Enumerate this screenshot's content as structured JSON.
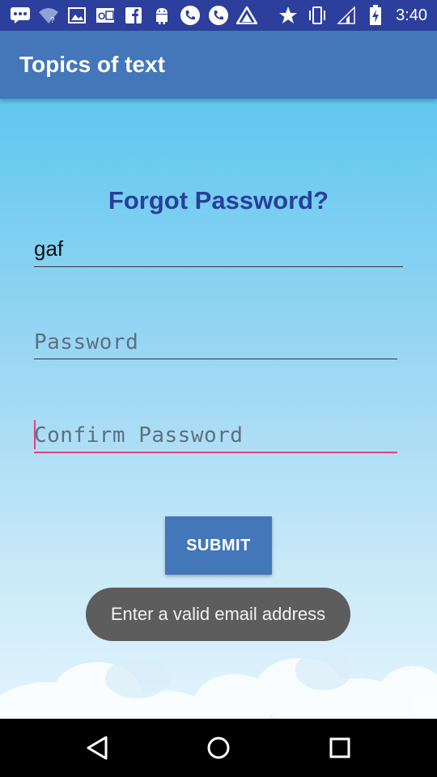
{
  "status_bar": {
    "time": "3:40",
    "icons_left": [
      "chat-icon",
      "wifi-question-icon",
      "image-icon",
      "outlook-icon",
      "facebook-icon",
      "android-icon",
      "phone-icon",
      "phone-icon",
      "app-icon"
    ],
    "icons_right": [
      "star-icon",
      "vibrate-icon",
      "signal-icon",
      "battery-charging-icon"
    ]
  },
  "app_bar": {
    "title": "Topics of text"
  },
  "form": {
    "heading": "Forgot Password?",
    "email_value": "gaf",
    "password_placeholder": "Password",
    "confirm_placeholder": "Confirm Password",
    "submit_label": "SUBMIT"
  },
  "toast": {
    "message": "Enter a valid email address"
  },
  "colors": {
    "status_bar": "#2d3f9c",
    "app_bar": "#4377b9",
    "heading": "#283f9b",
    "accent": "#e0457a",
    "toast": "#5d5d5d"
  },
  "nav_bar": {
    "buttons": [
      "back-icon",
      "home-icon",
      "recents-icon"
    ]
  }
}
